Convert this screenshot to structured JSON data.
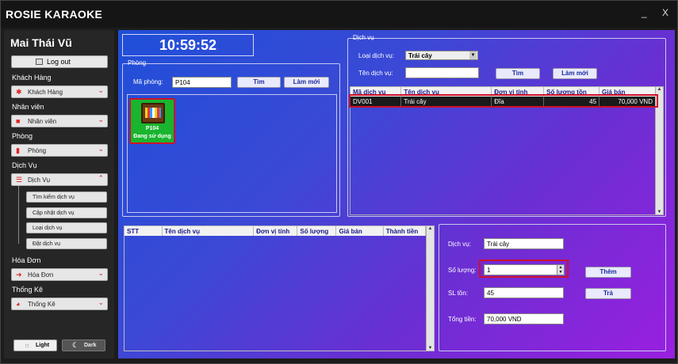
{
  "app": {
    "title": "ROSIE KARAOKE",
    "minimize": "_",
    "close": "X"
  },
  "sidebar": {
    "user": "Mai Thái Vũ",
    "logout": "Log out",
    "sections": [
      {
        "title": "Khách Hàng",
        "button": "Khách Hàng"
      },
      {
        "title": "Nhân viên",
        "button": "Nhân viên"
      },
      {
        "title": "Phòng",
        "button": "Phòng"
      },
      {
        "title": "Dịch Vụ",
        "button": "Dịch Vụ"
      },
      {
        "title": "Hóa Đơn",
        "button": "Hóa Đơn"
      },
      {
        "title": "Thống Kê",
        "button": "Thống Kê"
      }
    ],
    "dichvu_sub": [
      "Tìm kiếm dịch vụ",
      "Cập nhật dịch vụ",
      "Loại dịch vụ",
      "Đặt dịch vụ"
    ],
    "light": "Light",
    "dark": "Dark"
  },
  "clock": "10:59:52",
  "phong": {
    "group": "Phòng",
    "label": "Mã phòng:",
    "value": "P104",
    "search": "Tìm",
    "reset": "Làm mới",
    "room": {
      "code": "P104",
      "status": "Đang sử dụng"
    }
  },
  "dichvu": {
    "group": "Dịch vụ",
    "type_label": "Loại dịch vụ:",
    "type_value": "Trái cây",
    "name_label": "Tên dịch vụ:",
    "name_value": "",
    "search": "Tìm",
    "reset": "Làm mới",
    "columns": [
      "Mã dịch vụ",
      "Tên dịch vụ",
      "Đơn vị tính",
      "Số lượng tồn",
      "Giá bán"
    ],
    "rows": [
      [
        "DV001",
        "Trái cây",
        "Đĩa",
        "45",
        "70,000 VND"
      ]
    ]
  },
  "order": {
    "columns": [
      "STT",
      "Tên dịch vụ",
      "Đơn vị tính",
      "Số lượng",
      "Giá bán",
      "Thành tiền"
    ]
  },
  "form": {
    "svc_label": "Dịch vụ:",
    "svc_value": "Trái cây",
    "qty_label": "Số lượng:",
    "qty_value": "1",
    "stock_label": "SL tồn:",
    "stock_value": "45",
    "total_label": "Tổng tiền:",
    "total_value": "70,000 VND",
    "add": "Thêm",
    "return": "Trả"
  }
}
